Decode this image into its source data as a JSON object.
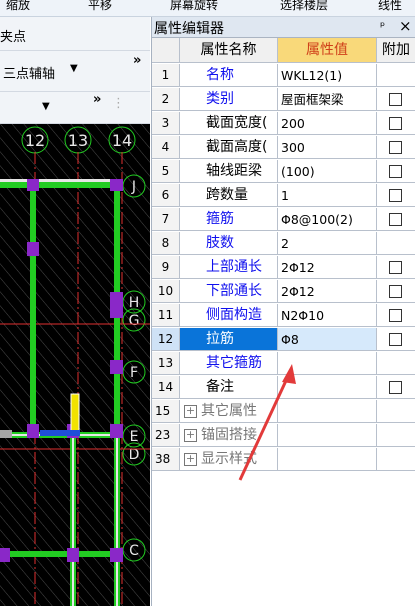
{
  "toolbar": {
    "zoom": "缩放",
    "pan": "平移",
    "rotate": "屏幕旋转",
    "select_layer": "选择楼层",
    "line": "线性"
  },
  "left_toolbar": {
    "snap": "夹点",
    "axis_mode": "三点辅轴",
    "more": "»"
  },
  "canvas": {
    "axis_top": [
      "12",
      "13",
      "14"
    ],
    "axis_right": [
      "J",
      "H",
      "G",
      "F",
      "E",
      "D",
      "C"
    ]
  },
  "editor": {
    "title": "属性编辑器",
    "pin": "ᵖ",
    "close": "×",
    "columns": {
      "name": "属性名称",
      "value": "属性值",
      "extra": "附加"
    },
    "rows": [
      {
        "num": "1",
        "name": "名称",
        "value": "WKL12(1)",
        "blue": true,
        "checkbox": false
      },
      {
        "num": "2",
        "name": "类别",
        "value": "屋面框架梁",
        "blue": true,
        "checkbox": true
      },
      {
        "num": "3",
        "name": "截面宽度(",
        "value": "200",
        "blue": false,
        "checkbox": true
      },
      {
        "num": "4",
        "name": "截面高度(",
        "value": "300",
        "blue": false,
        "checkbox": true
      },
      {
        "num": "5",
        "name": "轴线距梁",
        "value": "(100)",
        "blue": false,
        "checkbox": true
      },
      {
        "num": "6",
        "name": "跨数量",
        "value": "1",
        "blue": false,
        "checkbox": true
      },
      {
        "num": "7",
        "name": "箍筋",
        "value": "Φ8@100(2)",
        "blue": true,
        "checkbox": true
      },
      {
        "num": "8",
        "name": "肢数",
        "value": "2",
        "blue": true,
        "checkbox": false
      },
      {
        "num": "9",
        "name": "上部通长",
        "value": "2Φ12",
        "blue": true,
        "checkbox": true
      },
      {
        "num": "10",
        "name": "下部通长",
        "value": "2Φ12",
        "blue": true,
        "checkbox": true
      },
      {
        "num": "11",
        "name": "侧面构造",
        "value": "N2Φ10",
        "blue": true,
        "checkbox": true
      },
      {
        "num": "12",
        "name": "拉筋",
        "value": "Φ8",
        "blue": true,
        "checkbox": true,
        "selected": true
      },
      {
        "num": "13",
        "name": "其它箍筋",
        "value": "",
        "blue": true,
        "checkbox": false
      },
      {
        "num": "14",
        "name": "备注",
        "value": "",
        "blue": false,
        "checkbox": true
      }
    ],
    "groups": [
      {
        "num": "15",
        "name": "其它属性"
      },
      {
        "num": "23",
        "name": "锚固搭接"
      },
      {
        "num": "38",
        "name": "显示样式"
      }
    ]
  },
  "colors": {
    "selected_row": "#0a74d9",
    "value_header": "#f9d97a",
    "beam": "#22cc22",
    "column": "#8a28c8",
    "annotation_arrow": "#e23a3a"
  }
}
